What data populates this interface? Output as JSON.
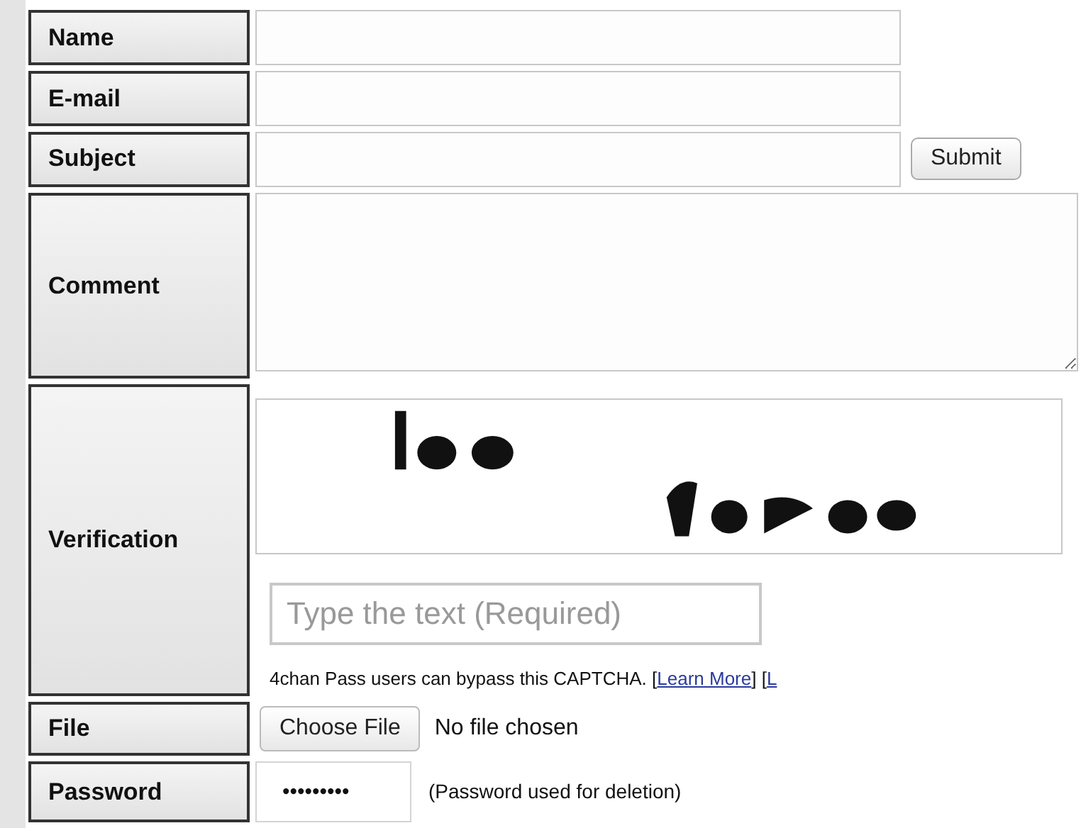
{
  "rows": [
    {
      "label": "Name",
      "kind": "text"
    },
    {
      "label": "E-mail",
      "kind": "text"
    },
    {
      "label": "Subject",
      "kind": "text",
      "button": "Submit"
    },
    {
      "label": "Comment",
      "kind": "textarea"
    },
    {
      "label": "Verification",
      "kind": "captcha",
      "placeholder": "Type the text (Required)",
      "note": [
        {
          "kind": "text",
          "text": "4chan Pass users can bypass this CAPTCHA. ["
        },
        {
          "kind": "link",
          "text": "Learn More"
        },
        {
          "kind": "text",
          "text": "] ["
        },
        {
          "kind": "link",
          "text": "L"
        }
      ]
    },
    {
      "label": "File",
      "kind": "file",
      "button": "Choose File",
      "status": "No file chosen"
    },
    {
      "label": "Password",
      "kind": "password",
      "value": "•••••••••",
      "note": "(Password used for deletion)"
    }
  ]
}
